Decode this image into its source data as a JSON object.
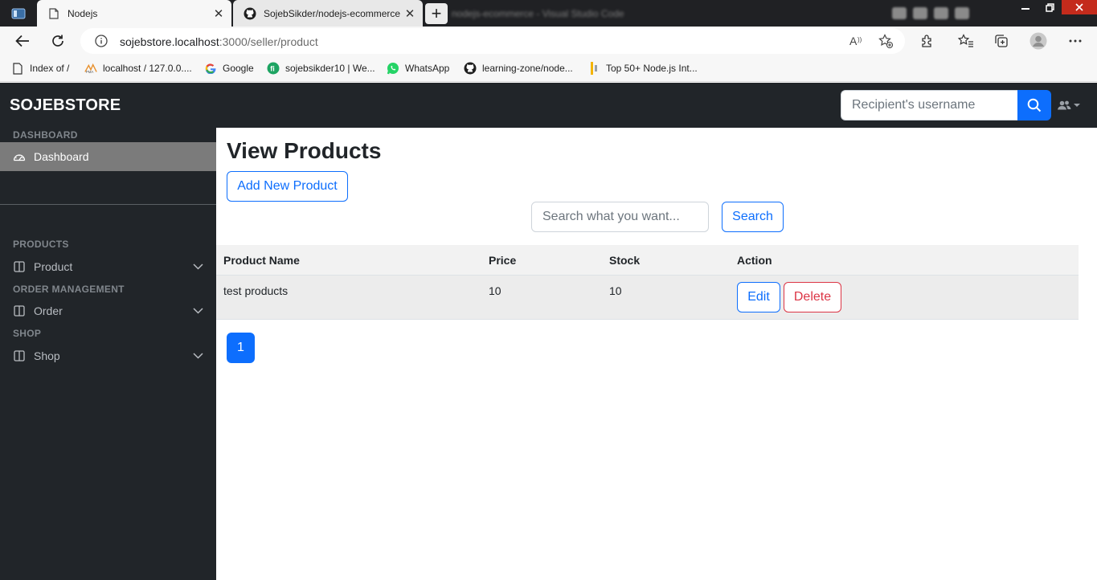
{
  "browser": {
    "tabs": [
      {
        "title": "Nodejs",
        "active": true
      },
      {
        "title": "SojebSikder/nodejs-ecommerce",
        "active": false
      }
    ],
    "background_window_title": "nodejs-ecommerce - Visual Studio Code",
    "url_host": "sojebstore.localhost",
    "url_path": ":3000/seller/product",
    "bookmarks": [
      {
        "label": "Index of /",
        "icon": "file-icon"
      },
      {
        "label": "localhost / 127.0.0....",
        "icon": "phpmyadmin-icon"
      },
      {
        "label": "Google",
        "icon": "google-icon"
      },
      {
        "label": "sojebsikder10 | We...",
        "icon": "green-badge-icon"
      },
      {
        "label": "WhatsApp",
        "icon": "whatsapp-icon"
      },
      {
        "label": "learning-zone/node...",
        "icon": "github-icon"
      },
      {
        "label": "Top 50+ Node.js Int...",
        "icon": "bookmark-bar-icon"
      }
    ]
  },
  "app": {
    "brand": "SOJEBSTORE",
    "recipient_placeholder": "Recipient's username",
    "sidebar": {
      "sections": [
        {
          "heading": "DASHBOARD",
          "items": [
            {
              "label": "Dashboard",
              "icon": "dashboard-gauge-icon",
              "active": true
            }
          ]
        },
        {
          "heading": "PRODUCTS",
          "items": [
            {
              "label": "Product",
              "icon": "columns-icon"
            }
          ]
        },
        {
          "heading": "ORDER MANAGEMENT",
          "items": [
            {
              "label": "Order",
              "icon": "columns-icon"
            }
          ]
        },
        {
          "heading": "SHOP",
          "items": [
            {
              "label": "Shop",
              "icon": "columns-icon"
            }
          ]
        }
      ]
    },
    "main": {
      "title": "View Products",
      "add_button": "Add New Product",
      "search_placeholder": "Search what you want...",
      "search_button": "Search",
      "table": {
        "columns": [
          "Product Name",
          "Price",
          "Stock",
          "Action"
        ],
        "rows": [
          {
            "name": "test products",
            "price": "10",
            "stock": "10",
            "edit": "Edit",
            "delete": "Delete"
          }
        ]
      },
      "pagination": {
        "current_page": "1"
      }
    },
    "colors": {
      "primary": "#0d6efd",
      "danger": "#dc3545",
      "dark": "#212529",
      "sidebar_active": "#7b7b7b"
    }
  }
}
